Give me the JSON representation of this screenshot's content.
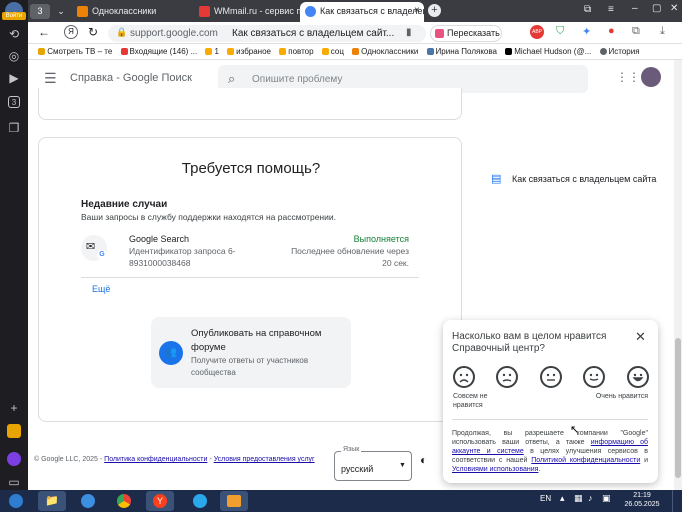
{
  "sidebar": {
    "login": "Войти",
    "count": "3"
  },
  "tabs": [
    {
      "label": "3",
      "color": "#5f6368"
    },
    {
      "label": "Одноклассники",
      "color": "#ee8208"
    },
    {
      "label": "WMmail.ru - сервис почт",
      "color": "#e53935"
    },
    {
      "label": "Как связаться с владелец",
      "color": "#4285f4"
    }
  ],
  "toolbar": {
    "url_host": "support.google.com",
    "page_title": "Как связаться с владельцем сайт...",
    "retell": "Пересказать"
  },
  "bookmarks": [
    "Смотреть ТВ – те",
    "Входящие (146) ...",
    "1",
    "избраное",
    "повтор",
    "соц",
    "Одноклассники",
    "Ирина Полякова",
    "Michael Hudson (@...",
    "История"
  ],
  "header": {
    "title": "Справка - Google Поиск",
    "search_placeholder": "Опишите проблему"
  },
  "help": {
    "heading": "Требуется помощь?",
    "recent_title": "Недавние случаи",
    "recent_desc": "Ваши запросы в службу поддержки находятся на рассмотрении.",
    "case_product": "Google Search",
    "case_id_label": "Идентификатор запроса 6-",
    "case_id": "8931000038468",
    "case_status": "Выполняется",
    "case_update": "Последнее обновление через",
    "case_update_time": "20 сек.",
    "more": "Ещё",
    "forum_title": "Опубликовать на справочном",
    "forum_title2": "форуме",
    "forum_desc": "Получите ответы от участников",
    "forum_desc2": "сообщества"
  },
  "related": {
    "link": "Как связаться с владельцем сайта"
  },
  "footer": {
    "copyright": "© Google LLC, 2025 -",
    "privacy": "Политика конфиденциальности",
    "sep": "-",
    "terms": "Условия предоставления услуг",
    "lang_label": "Язык",
    "lang_value": "русский"
  },
  "survey": {
    "question": "Насколько вам в целом нравится",
    "question2": "Справочный центр?",
    "low_label": "Совсем не",
    "low_label2": "нравится",
    "high_label": "Очень нравится",
    "consent_1": "Продолжая, вы разрешаете компании \"Google\" использовать ваши ответы, а также",
    "consent_link1": "информацию об аккаунте и системе",
    "consent_2": "в целях улучшения сервисов в соответствии с нашей",
    "consent_link2": "Политикой конфиденциальности",
    "consent_3": "и",
    "consent_link3": "Условиями использования",
    "consent_4": "."
  },
  "taskbar": {
    "lang": "EN",
    "time": "21:19",
    "date": "26.05.2025"
  }
}
